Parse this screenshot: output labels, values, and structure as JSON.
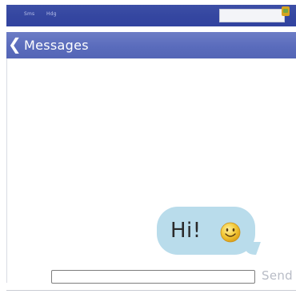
{
  "status_bar": {
    "left_text": "Sms",
    "right_text": "Hdg"
  },
  "header": {
    "back_icon": "chevron-left-icon",
    "title": "Messages"
  },
  "conversation": {
    "messages": [
      {
        "direction": "outgoing",
        "text": "Hi!",
        "emoji_icon": "smiley-icon"
      }
    ]
  },
  "composer": {
    "input_value": "",
    "input_placeholder": "",
    "send_label": "Send"
  },
  "colors": {
    "status_bar": "#3446a0",
    "header": "#5a6cbc",
    "bubble": "#b9dceb",
    "send_text": "#b8bcc6",
    "smiley_face": "#f2c837"
  }
}
